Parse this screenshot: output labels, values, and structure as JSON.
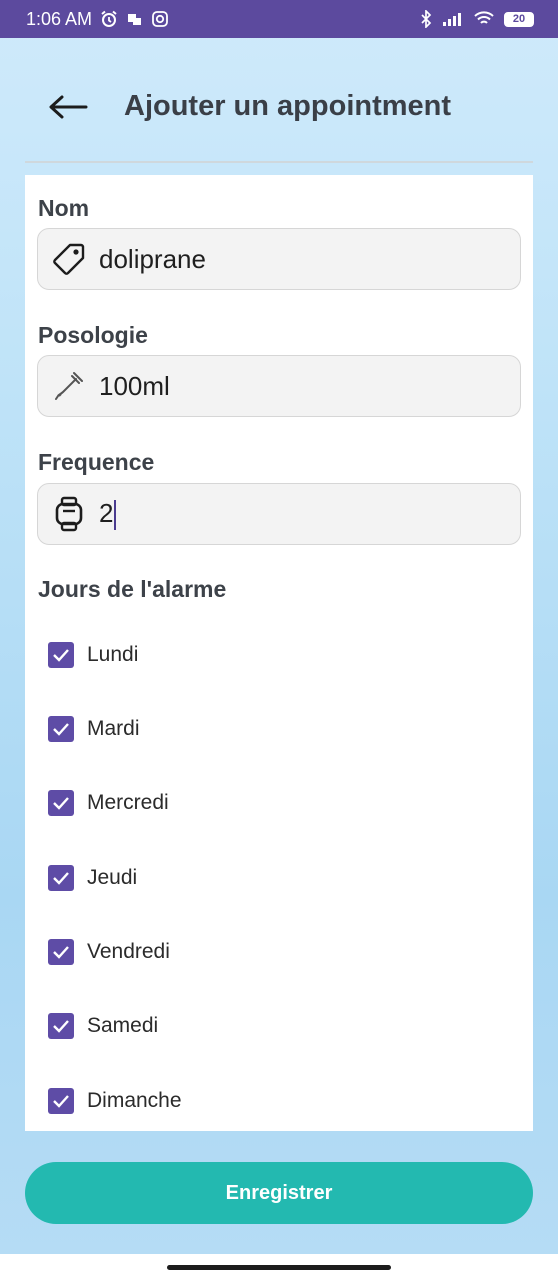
{
  "status_bar": {
    "time": "1:06 AM",
    "battery": "20",
    "icons": [
      "alarm-icon",
      "notification-icon",
      "instagram-icon",
      "bluetooth-icon",
      "signal-icon",
      "wifi-icon",
      "battery-icon"
    ]
  },
  "header": {
    "title": "Ajouter un appointment",
    "back_icon": "arrow-left-icon"
  },
  "form": {
    "nom": {
      "label": "Nom",
      "value": "doliprane",
      "icon": "tag-icon"
    },
    "posologie": {
      "label": "Posologie",
      "value": "100ml",
      "icon": "dropper-icon"
    },
    "frequence": {
      "label": "Frequence",
      "value": "2",
      "icon": "watch-icon"
    },
    "days": {
      "label": "Jours de l'alarme",
      "items": [
        {
          "label": "Lundi",
          "checked": true
        },
        {
          "label": "Mardi",
          "checked": true
        },
        {
          "label": "Mercredi",
          "checked": true
        },
        {
          "label": "Jeudi",
          "checked": true
        },
        {
          "label": "Vendredi",
          "checked": true
        },
        {
          "label": "Samedi",
          "checked": true
        },
        {
          "label": "Dimanche",
          "checked": true
        }
      ]
    }
  },
  "save_button": {
    "label": "Enregistrer"
  },
  "colors": {
    "status_bar": "#5c4a9e",
    "checkbox": "#5e4ca6",
    "button": "#23b9b0"
  }
}
